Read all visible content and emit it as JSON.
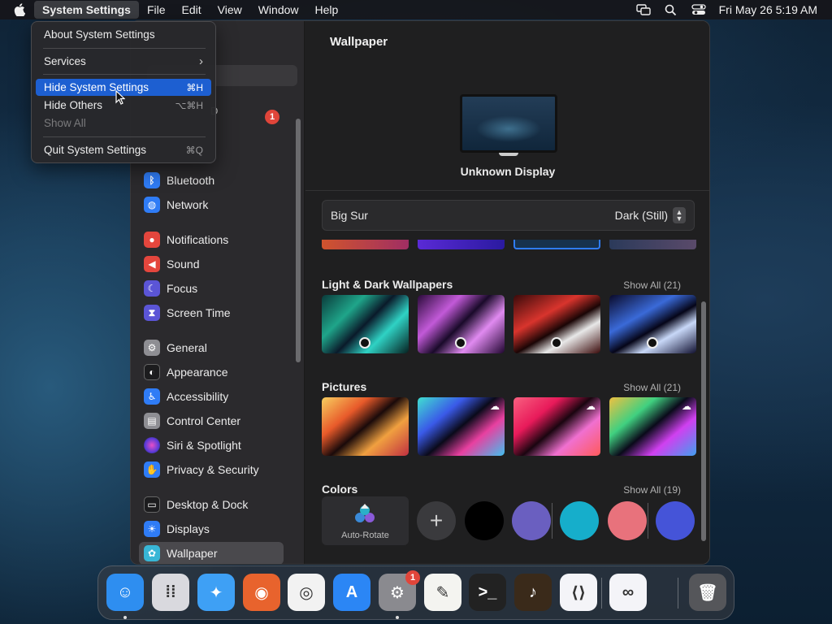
{
  "menubar": {
    "app_name": "System Settings",
    "menus": [
      "File",
      "Edit",
      "View",
      "Window",
      "Help"
    ],
    "status_icons": [
      "screen-mirroring-icon",
      "spotlight-search-icon",
      "control-center-icon"
    ],
    "clock": "Fri May 26  5:19 AM"
  },
  "app_menu": {
    "items": [
      {
        "label": "About System Settings",
        "shortcut": ""
      },
      {
        "label": "Services",
        "shortcut": "›"
      },
      {
        "label": "Hide System Settings",
        "shortcut": "⌘H"
      },
      {
        "label": "Hide Others",
        "shortcut": "⌥⌘H"
      },
      {
        "label": "Show All",
        "shortcut": ""
      },
      {
        "label": "Quit System Settings",
        "shortcut": "⌘Q"
      }
    ],
    "highlighted": "Hide System Settings",
    "disabled": "Show All"
  },
  "sidebar": {
    "account_partial": "D",
    "account_badge": "1",
    "items": [
      {
        "label": "Bluetooth",
        "icon": "bluetooth-icon",
        "color": "#2f7cf6",
        "glyph": "ᛒ"
      },
      {
        "label": "Network",
        "icon": "globe-icon",
        "color": "#2f7cf6",
        "glyph": "◍"
      },
      {
        "label": "Notifications",
        "icon": "bell-icon",
        "color": "#e4463d",
        "glyph": "●"
      },
      {
        "label": "Sound",
        "icon": "speaker-icon",
        "color": "#e4463d",
        "glyph": "◀"
      },
      {
        "label": "Focus",
        "icon": "moon-icon",
        "color": "#5b55d6",
        "glyph": "☾"
      },
      {
        "label": "Screen Time",
        "icon": "hourglass-icon",
        "color": "#5b55d6",
        "glyph": "⧗"
      },
      {
        "label": "General",
        "icon": "gear-icon",
        "color": "#8e8e93",
        "glyph": "⚙"
      },
      {
        "label": "Appearance",
        "icon": "appearance-icon",
        "color": "#1c1c1e",
        "glyph": "◐"
      },
      {
        "label": "Accessibility",
        "icon": "accessibility-icon",
        "color": "#2f7cf6",
        "glyph": "♿"
      },
      {
        "label": "Control Center",
        "icon": "control-center-icon",
        "color": "#8e8e93",
        "glyph": "▤"
      },
      {
        "label": "Siri & Spotlight",
        "icon": "siri-icon",
        "color": "#9b3fd6",
        "glyph": "◉"
      },
      {
        "label": "Privacy & Security",
        "icon": "hand-icon",
        "color": "#2f7cf6",
        "glyph": "✋"
      },
      {
        "label": "Desktop & Dock",
        "icon": "dock-icon",
        "color": "#1c1c1e",
        "glyph": "▭"
      },
      {
        "label": "Displays",
        "icon": "sun-icon",
        "color": "#2f7cf6",
        "glyph": "☀"
      },
      {
        "label": "Wallpaper",
        "icon": "wallpaper-icon",
        "color": "#38b6d6",
        "glyph": "✿"
      }
    ],
    "selected": "Wallpaper"
  },
  "main": {
    "title": "Wallpaper",
    "display_name": "Unknown Display",
    "wallpaper_name": "Big Sur",
    "wallpaper_style": "Dark (Still)",
    "sections": [
      {
        "title": "Light & Dark Wallpapers",
        "show_all": "Show All (21)"
      },
      {
        "title": "Pictures",
        "show_all": "Show All (21)"
      },
      {
        "title": "Colors",
        "show_all": "Show All (19)"
      }
    ],
    "auto_rotate_label": "Auto-Rotate",
    "colors": [
      "#000000",
      "#6a5fc0",
      "#16aecb",
      "#e8727c",
      "#4554d8"
    ]
  },
  "dock": {
    "apps": [
      {
        "name": "finder-icon",
        "bg": "#2e8ef0",
        "glyph": "☺",
        "running": true
      },
      {
        "name": "launchpad-icon",
        "bg": "#d9d9de",
        "glyph": "⁞⁞",
        "running": false
      },
      {
        "name": "safari-icon",
        "bg": "#3ea0f5",
        "glyph": "✦",
        "running": false
      },
      {
        "name": "firefox-icon",
        "bg": "#e8632d",
        "glyph": "◉",
        "running": false
      },
      {
        "name": "chrome-icon",
        "bg": "#f2f2f2",
        "glyph": "◎",
        "running": false
      },
      {
        "name": "app-store-icon",
        "bg": "#2b86f5",
        "glyph": "A",
        "running": false
      },
      {
        "name": "system-settings-icon",
        "bg": "#8a8a8f",
        "glyph": "⚙",
        "running": true,
        "badge": "1"
      },
      {
        "name": "textedit-icon",
        "bg": "#f4f4f0",
        "glyph": "✎",
        "running": false
      },
      {
        "name": "terminal-icon",
        "bg": "#222222",
        "glyph": ">_",
        "running": false
      },
      {
        "name": "garageband-icon",
        "bg": "#3a2a1a",
        "glyph": "♪",
        "running": false
      },
      {
        "name": "vscode-icon",
        "bg": "#f4f4f8",
        "glyph": "⟨⟩",
        "running": false
      },
      {
        "name": "visual-studio-icon",
        "bg": "#f4f4f8",
        "glyph": "∞",
        "running": false
      },
      {
        "name": "trash-icon",
        "bg": "#55565a",
        "glyph": "🗑",
        "running": false
      }
    ]
  }
}
